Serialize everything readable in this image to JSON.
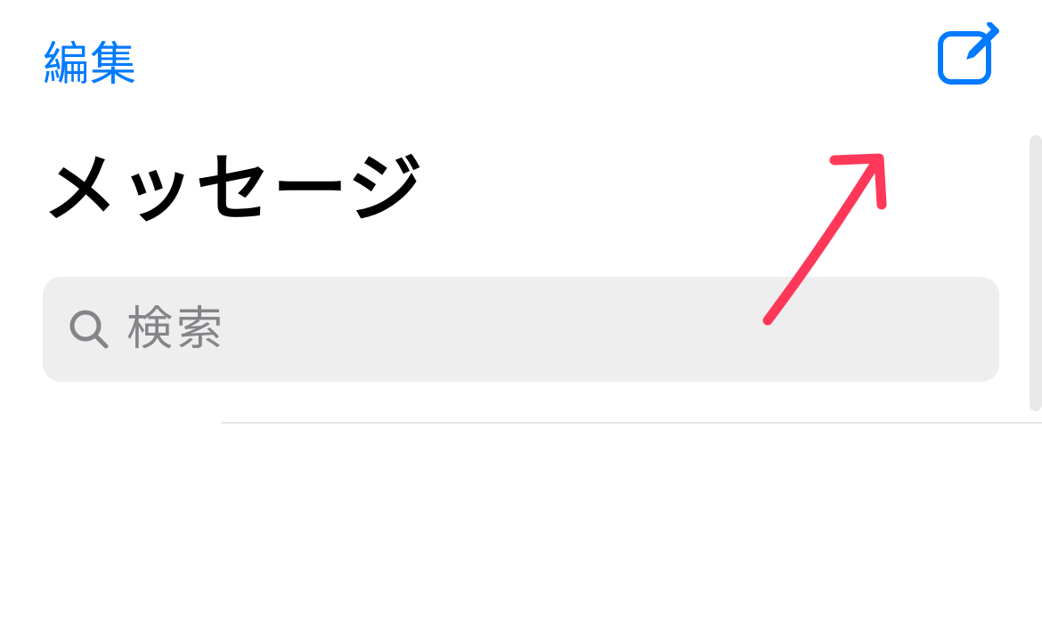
{
  "header": {
    "edit_label": "編集"
  },
  "page": {
    "title": "メッセージ"
  },
  "search": {
    "placeholder": "検索",
    "value": ""
  },
  "colors": {
    "accent": "#007aff",
    "annotation": "#ff3859",
    "search_bg": "#eeeeef",
    "placeholder": "#858589"
  },
  "icons": {
    "compose": "compose-icon",
    "search": "search-icon"
  }
}
